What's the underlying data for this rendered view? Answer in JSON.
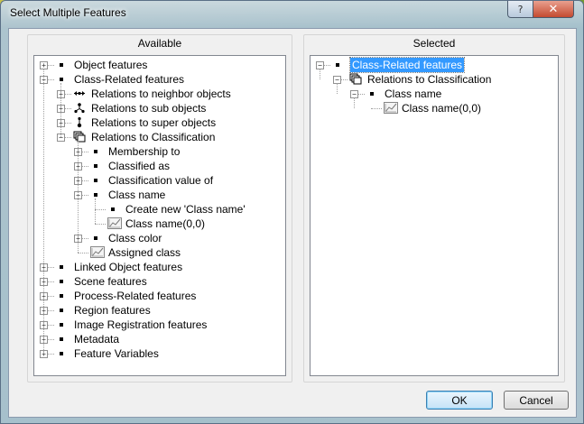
{
  "window": {
    "title": "Select Multiple Features",
    "help_glyph": "?",
    "close_glyph": "✕"
  },
  "available": {
    "label": "Available",
    "items": [
      {
        "label": "Object features",
        "expander": "+",
        "icon": "square-bullet-icon"
      },
      {
        "label": "Class-Related features",
        "expander": "-",
        "icon": "square-bullet-icon"
      },
      {
        "label": "Relations to neighbor objects",
        "expander": "+",
        "icon": "neighbor-relation-icon"
      },
      {
        "label": "Relations to sub objects",
        "expander": "+",
        "icon": "sub-objects-icon"
      },
      {
        "label": "Relations to super objects",
        "expander": "+",
        "icon": "super-objects-icon"
      },
      {
        "label": "Relations to Classification",
        "expander": "-",
        "icon": "classification-icon"
      },
      {
        "label": "Membership to",
        "expander": "+",
        "icon": "square-bullet-icon"
      },
      {
        "label": "Classified as",
        "expander": "+",
        "icon": "square-bullet-icon"
      },
      {
        "label": "Classification value of",
        "expander": "+",
        "icon": "square-bullet-icon"
      },
      {
        "label": "Class name",
        "expander": "-",
        "icon": "square-bullet-icon"
      },
      {
        "label": "Create new 'Class name'",
        "expander": "",
        "icon": "square-bullet-icon"
      },
      {
        "label": "Class name(0,0)",
        "expander": "",
        "icon": "feature-chart-icon"
      },
      {
        "label": "Class color",
        "expander": "+",
        "icon": "square-bullet-icon"
      },
      {
        "label": "Assigned class",
        "expander": "",
        "icon": "feature-chart-icon"
      },
      {
        "label": "Linked Object features",
        "expander": "+",
        "icon": "square-bullet-icon"
      },
      {
        "label": "Scene features",
        "expander": "+",
        "icon": "square-bullet-icon"
      },
      {
        "label": "Process-Related features",
        "expander": "+",
        "icon": "square-bullet-icon"
      },
      {
        "label": "Region features",
        "expander": "+",
        "icon": "square-bullet-icon"
      },
      {
        "label": "Image Registration features",
        "expander": "+",
        "icon": "square-bullet-icon"
      },
      {
        "label": "Metadata",
        "expander": "+",
        "icon": "square-bullet-icon"
      },
      {
        "label": "Feature Variables",
        "expander": "+",
        "icon": "square-bullet-icon"
      }
    ]
  },
  "selected": {
    "label": "Selected",
    "items": [
      {
        "label": "Class-Related features",
        "expander": "-",
        "icon": "square-bullet-icon",
        "selected": true
      },
      {
        "label": "Relations to Classification",
        "expander": "-",
        "icon": "classification-icon"
      },
      {
        "label": "Class name",
        "expander": "-",
        "icon": "square-bullet-icon"
      },
      {
        "label": "Class name(0,0)",
        "expander": "",
        "icon": "feature-chart-icon"
      }
    ]
  },
  "buttons": {
    "ok": "OK",
    "cancel": "Cancel"
  }
}
